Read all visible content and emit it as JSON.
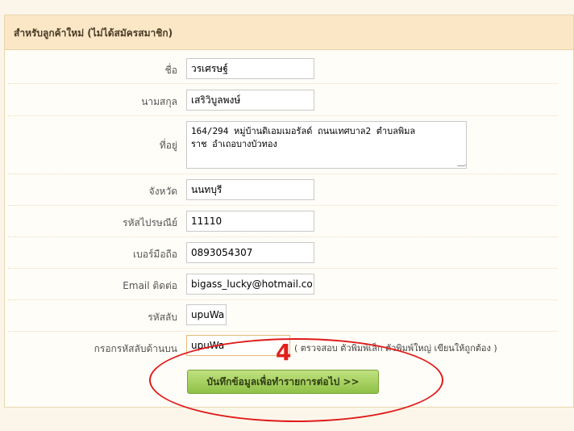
{
  "panel": {
    "title": "สำหรับลูกค้าใหม่ (ไม่ได้สมัครสมาชิก)"
  },
  "fields": {
    "first_name": {
      "label": "ชื่อ",
      "value": "วรเศรษฐ์"
    },
    "last_name": {
      "label": "นามสกุล",
      "value": "เสริวิบูลพงษ์"
    },
    "address": {
      "label": "ที่อยู่",
      "line1": "164/294 หมู่บ้านดิเอมเมอรัลด์ ถนนเทศบาล2 ตำบลพิมล",
      "line2": "ราช อำเถอบางบัวทอง"
    },
    "province": {
      "label": "จังหวัด",
      "value": "นนทบุรี"
    },
    "postal_code": {
      "label": "รหัสไปรษณีย์",
      "value": "11110"
    },
    "mobile": {
      "label": "เบอร์มือถือ",
      "value": "0893054307"
    },
    "email": {
      "label": "Email ติดต่อ",
      "value": "bigass_lucky@hotmail.co"
    },
    "captcha": {
      "label": "รหัสลับ",
      "value": "upuWa"
    },
    "captcha_confirm": {
      "label": "กรอกรหัสลับด้านบน",
      "value": "upuWa",
      "hint": "( ตรวจสอบ ตัวพิมพ์เล็ก ตัวพิมพ์ใหญ่ เขียนให้ถูกต้อง )"
    }
  },
  "submit_label": "บันทึกข้อมูลเพื่อทำรายการต่อไป >>",
  "annotation": {
    "number": "4",
    "color": "#e0201a"
  },
  "colors": {
    "header_bg": "#fbe7c6",
    "button_green": "#a7d160",
    "page_bg": "#fbf6e9"
  }
}
